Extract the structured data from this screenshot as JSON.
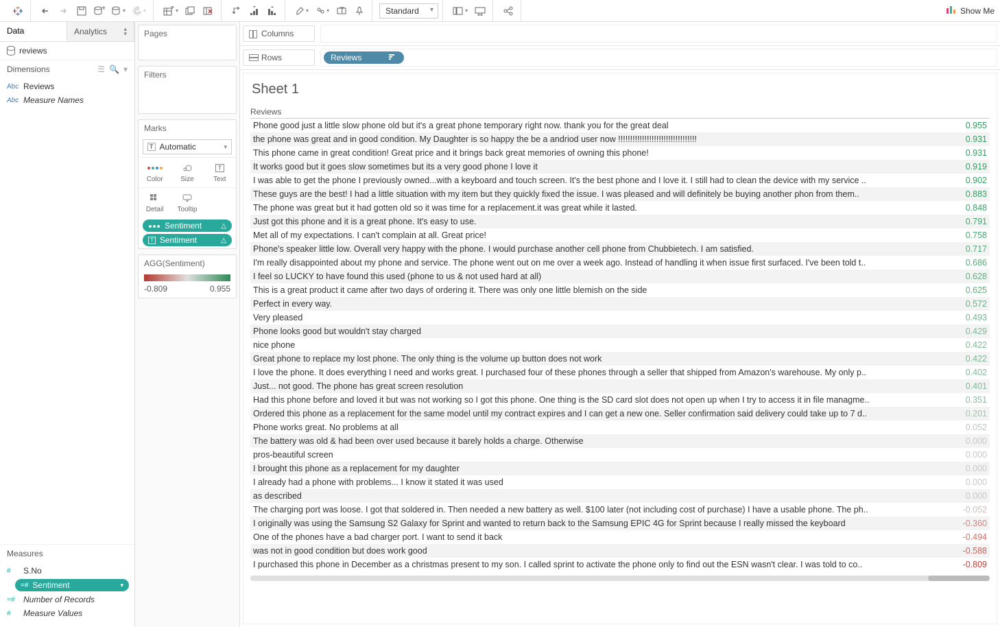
{
  "toolbar": {
    "fit": "Standard",
    "showme": "Show Me"
  },
  "left": {
    "tab_data": "Data",
    "tab_analytics": "Analytics",
    "datasource": "reviews",
    "dimensions_label": "Dimensions",
    "dim_reviews": "Reviews",
    "dim_measure_names": "Measure Names",
    "measures_label": "Measures",
    "m_sno": "S.No",
    "m_sentiment": "Sentiment",
    "m_records": "Number of Records",
    "m_values": "Measure Values"
  },
  "mid": {
    "pages": "Pages",
    "filters": "Filters",
    "marks": "Marks",
    "marks_type": "Automatic",
    "color": "Color",
    "size": "Size",
    "text": "Text",
    "detail": "Detail",
    "tooltip": "Tooltip",
    "pill_sentiment_1": "Sentiment",
    "pill_sentiment_2": "Sentiment",
    "agg_title": "AGG(Sentiment)",
    "agg_min": "-0.809",
    "agg_max": "0.955"
  },
  "shelves": {
    "columns": "Columns",
    "rows": "Rows",
    "pill_reviews": "Reviews"
  },
  "sheet": {
    "title": "Sheet 1",
    "col_header": "Reviews",
    "rows": [
      {
        "text": "Phone good just a little slow phone old but it's a great phone temporary right now. thank you for the great deal",
        "val": 0.955
      },
      {
        "text": "the phone was great and in good condition. My Daughter is so happy the be a andriod user now !!!!!!!!!!!!!!!!!!!!!!!!!!!!!!!!!",
        "val": 0.931
      },
      {
        "text": "This phone came in great condition! Great price and it brings back great memories of owning this phone!",
        "val": 0.931
      },
      {
        "text": "It works good but it goes slow sometimes but its a very good phone I love it",
        "val": 0.919
      },
      {
        "text": "I was able to get the phone I previously owned...with a keyboard and touch screen. It's the best phone and I love it. I still had to clean the device with my service ..",
        "val": 0.902
      },
      {
        "text": "These guys are the best! I had a little situation with my item but they quickly fixed the issue. I was pleased and will definitely be buying another phon from them..",
        "val": 0.883
      },
      {
        "text": "The phone was great but it had gotten old so it was time for a replacement.it was great while it lasted.",
        "val": 0.848
      },
      {
        "text": "Just got this phone and it is a great phone. It's easy to use.",
        "val": 0.791
      },
      {
        "text": "Met all of my expectations. I can't complain at all. Great price!",
        "val": 0.758
      },
      {
        "text": "Phone's speaker little low. Overall very happy with the phone. I would purchase another cell phone from Chubbietech. I am satisfied.",
        "val": 0.717
      },
      {
        "text": "I'm really disappointed about my phone and service. The phone went out on me over a week ago. Instead of handling it when issue first surfaced. I've been told t..",
        "val": 0.686
      },
      {
        "text": "I feel so LUCKY to have found this used (phone to us & not used hard at all)",
        "val": 0.628
      },
      {
        "text": "This is a great product it came after two days of ordering it. There was only one little blemish on the side",
        "val": 0.625
      },
      {
        "text": "Perfect in every way.",
        "val": 0.572
      },
      {
        "text": "Very pleased",
        "val": 0.493
      },
      {
        "text": "Phone looks good but wouldn't stay charged",
        "val": 0.429
      },
      {
        "text": "nice phone",
        "val": 0.422
      },
      {
        "text": "Great phone to replace my lost phone. The only thing is the volume up button does not work",
        "val": 0.422
      },
      {
        "text": "I love the phone. It does everything I need and works great. I purchased four of these phones through a seller that shipped from Amazon's warehouse. My only p..",
        "val": 0.402
      },
      {
        "text": "Just... not good. The phone has great screen resolution",
        "val": 0.401
      },
      {
        "text": "Had this phone before and loved it but was not working so I got this phone. One thing is the SD card slot does not open up when I try to access it in file managme..",
        "val": 0.351
      },
      {
        "text": "Ordered this phone as a replacement for the same model until my contract expires and I can get a new one. Seller confirmation said delivery could take up to 7 d..",
        "val": 0.201
      },
      {
        "text": "Phone works great. No problems at all",
        "val": 0.052
      },
      {
        "text": "The battery was old & had been over used because it barely holds a charge. Otherwise",
        "val": 0.0
      },
      {
        "text": "pros-beautiful screen",
        "val": 0.0
      },
      {
        "text": "I brought this phone as a replacement for my daughter",
        "val": 0.0
      },
      {
        "text": "I already had a phone with problems... I know it stated it was used",
        "val": 0.0
      },
      {
        "text": "as described",
        "val": 0.0
      },
      {
        "text": "The charging port was loose. I got that soldered in. Then needed a new battery as well. $100 later (not including cost of purchase) I have a usable phone. The ph..",
        "val": -0.052
      },
      {
        "text": "I originally was using the Samsung S2 Galaxy for Sprint and wanted to return back to the Samsung EPIC 4G for Sprint because I really missed the keyboard",
        "val": -0.36
      },
      {
        "text": "One of the phones have a bad charger port. I want to send it back",
        "val": -0.494
      },
      {
        "text": "was not in good condition but does work good",
        "val": -0.588
      },
      {
        "text": "I purchased this phone in December as a christmas present to my son. I called sprint to activate the phone only to find out the ESN wasn't clear. I was told to co..",
        "val": -0.809
      }
    ]
  },
  "chart_data": {
    "type": "table",
    "title": "Sheet 1",
    "columns": [
      "Reviews",
      "Sentiment"
    ],
    "color_scale": {
      "min": -0.809,
      "max": 0.955,
      "low_color": "#b33a2f",
      "zero_color": "#c8c8c8",
      "high_color": "#2e8b57"
    },
    "rows": [
      [
        "Phone good just a little slow phone old but it's a great phone temporary right now. thank you for the great deal",
        0.955
      ],
      [
        "the phone was great and in good condition. My Daughter is so happy the be a andriod user now !!!!!!!!!!!!!!!!!!!!!!!!!!!!!!!!!",
        0.931
      ],
      [
        "This phone came in great condition! Great price and it brings back great memories of owning this phone!",
        0.931
      ],
      [
        "It works good but it goes slow sometimes but its a very good phone I love it",
        0.919
      ],
      [
        "I was able to get the phone I previously owned...with a keyboard and touch screen. It's the best phone and I love it. I still had to clean the device with my service ..",
        0.902
      ],
      [
        "These guys are the best! I had a little situation with my item but they quickly fixed the issue. I was pleased and will definitely be buying another phon from them..",
        0.883
      ],
      [
        "The phone was great but it had gotten old so it was time for a replacement.it was great while it lasted.",
        0.848
      ],
      [
        "Just got this phone and it is a great phone. It's easy to use.",
        0.791
      ],
      [
        "Met all of my expectations. I can't complain at all. Great price!",
        0.758
      ],
      [
        "Phone's speaker little low. Overall very happy with the phone. I would purchase another cell phone from Chubbietech. I am satisfied.",
        0.717
      ],
      [
        "I'm really disappointed about my phone and service. The phone went out on me over a week ago. Instead of handling it when issue first surfaced. I've been told t..",
        0.686
      ],
      [
        "I feel so LUCKY to have found this used (phone to us & not used hard at all)",
        0.628
      ],
      [
        "This is a great product it came after two days of ordering it. There was only one little blemish on the side",
        0.625
      ],
      [
        "Perfect in every way.",
        0.572
      ],
      [
        "Very pleased",
        0.493
      ],
      [
        "Phone looks good but wouldn't stay charged",
        0.429
      ],
      [
        "nice phone",
        0.422
      ],
      [
        "Great phone to replace my lost phone. The only thing is the volume up button does not work",
        0.422
      ],
      [
        "I love the phone. It does everything I need and works great. I purchased four of these phones through a seller that shipped from Amazon's warehouse. My only p..",
        0.402
      ],
      [
        "Just... not good. The phone has great screen resolution",
        0.401
      ],
      [
        "Had this phone before and loved it but was not working so I got this phone. One thing is the SD card slot does not open up when I try to access it in file managme..",
        0.351
      ],
      [
        "Ordered this phone as a replacement for the same model until my contract expires and I can get a new one. Seller confirmation said delivery could take up to 7 d..",
        0.201
      ],
      [
        "Phone works great. No problems at all",
        0.052
      ],
      [
        "The battery was old & had been over used because it barely holds a charge. Otherwise",
        0.0
      ],
      [
        "pros-beautiful screen",
        0.0
      ],
      [
        "I brought this phone as a replacement for my daughter",
        0.0
      ],
      [
        "I already had a phone with problems... I know it stated it was used",
        0.0
      ],
      [
        "as described",
        0.0
      ],
      [
        "The charging port was loose. I got that soldered in. Then needed a new battery as well. $100 later (not including cost of purchase) I have a usable phone. The ph..",
        -0.052
      ],
      [
        "I originally was using the Samsung S2 Galaxy for Sprint and wanted to return back to the Samsung EPIC 4G for Sprint because I really missed the keyboard",
        -0.36
      ],
      [
        "One of the phones have a bad charger port. I want to send it back",
        -0.494
      ],
      [
        "was not in good condition but does work good",
        -0.588
      ],
      [
        "I purchased this phone in December as a christmas present to my son. I called sprint to activate the phone only to find out the ESN wasn't clear. I was told to co..",
        -0.809
      ]
    ]
  }
}
